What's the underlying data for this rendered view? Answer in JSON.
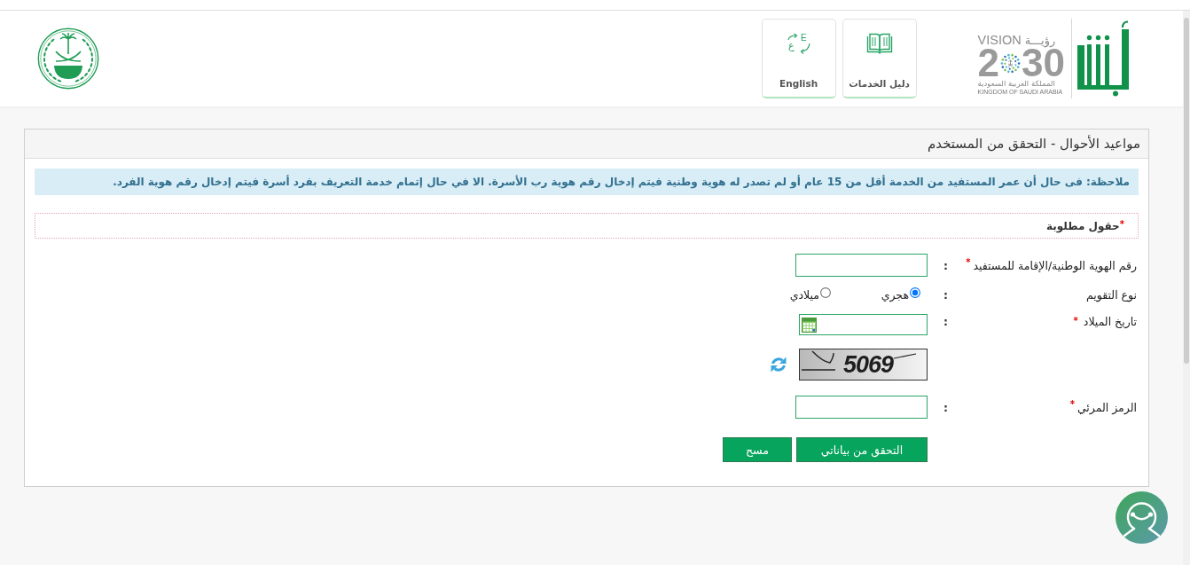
{
  "header": {
    "vision_logo": {
      "word_en": "VISION",
      "word_ar": "رؤيـــة",
      "year_start": "2",
      "year_end": "30",
      "country_ar": "المملكة العربية السعودية",
      "country_en": "KINGDOM OF SAUDI ARABIA"
    },
    "links": [
      {
        "kind": "guide",
        "label": "دليل الخدمات"
      },
      {
        "kind": "language",
        "label": "English",
        "icon_letters": [
          "E",
          "ع"
        ]
      }
    ]
  },
  "panel": {
    "title": "مواعيد الأحوال - التحقق من المستخدم",
    "note": "ملاحظة: فى حال أن عمر المستفيد من الخدمة أقل من 15 عام أو لم تصدر له هوية وطنية فيتم إدخال رقم هوية رب الأسرة. الا في حال إتمام خدمة التعريف بفرد أسرة فيتم إدخال رقم هوية الفرد.",
    "required_legend": {
      "mark": "*",
      "text": "حقول مطلوبة"
    },
    "fields": [
      {
        "kind": "text",
        "label": "رقم الهوية الوطنية/الإقامة للمستفيد",
        "required_mark": "*",
        "separator": ":"
      },
      {
        "kind": "radio",
        "label": "نوع التقويم",
        "separator": ":",
        "options": [
          {
            "label": "هجري",
            "selected": true
          },
          {
            "label": "ميلادي",
            "selected": false
          }
        ]
      },
      {
        "kind": "date",
        "label": "تاريخ الميلاد",
        "required_mark": "*",
        "separator": ":"
      },
      {
        "kind": "captcha",
        "code": "5069"
      },
      {
        "kind": "text",
        "label": "الرمز المرئي",
        "required_mark": "*",
        "separator": ":"
      }
    ],
    "buttons": [
      {
        "kind": "submit",
        "label": "التحقق من بياناتي"
      },
      {
        "kind": "reset",
        "label": "مسح"
      }
    ]
  }
}
